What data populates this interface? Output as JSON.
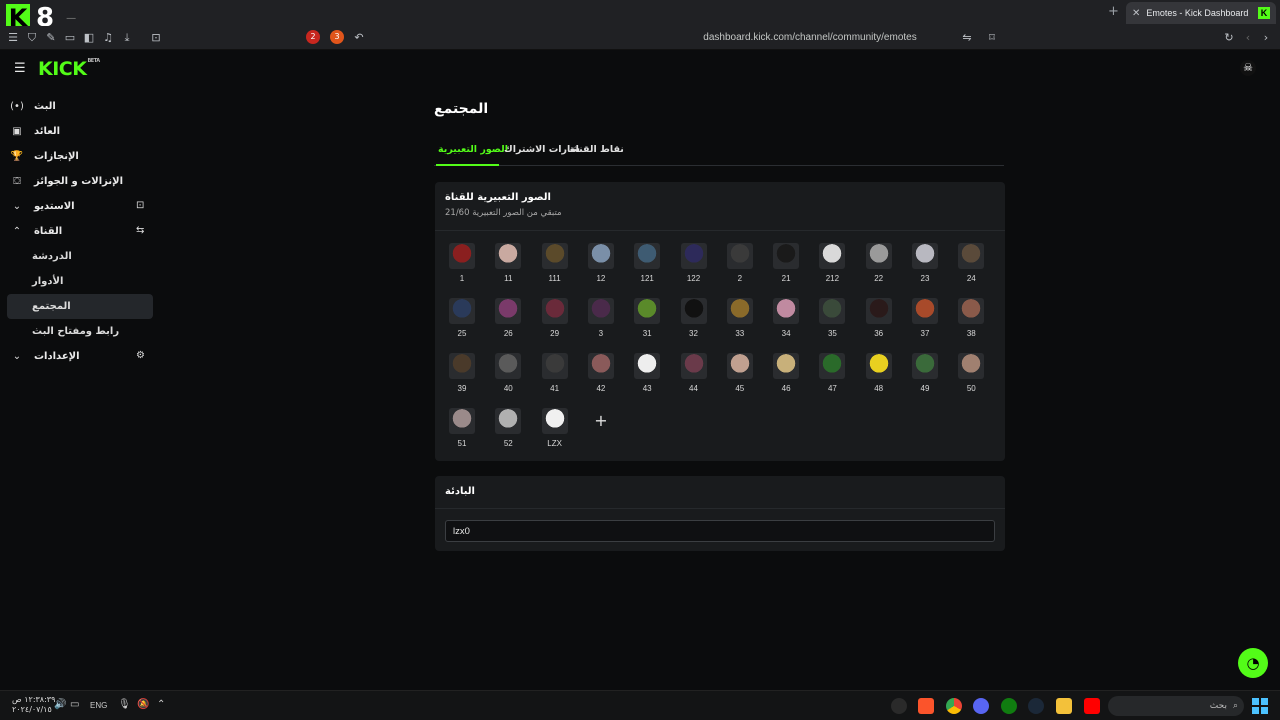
{
  "browser": {
    "logo_number": "8",
    "active_tab_title": "Emotes - Kick Dashboard",
    "url": "dashboard.kick.com/channel/community/emotes",
    "ext_badge_1": "2",
    "ext_badge_2": "3"
  },
  "header": {
    "logo": "KICK",
    "logo_badge": "BETA"
  },
  "sidebar": {
    "items": [
      {
        "label": "البث",
        "icon": "broadcast-icon",
        "glyph": "(•)"
      },
      {
        "label": "العائد",
        "icon": "revenue-icon",
        "glyph": "▣"
      },
      {
        "label": "الإنجازات",
        "icon": "trophy-icon",
        "glyph": "🏆"
      },
      {
        "label": "الإنزالات و الجوائز",
        "icon": "drops-icon",
        "glyph": "⛋"
      },
      {
        "label": "الاستديو",
        "icon": "chevron-down-icon",
        "glyph": "⌄",
        "right": "⊡"
      },
      {
        "label": "القناة",
        "icon": "chevron-up-icon",
        "glyph": "⌃",
        "right": "⇆"
      }
    ],
    "channel_sub": [
      "الدردشة",
      "الأدوار",
      "المجتمع",
      "رابط ومفتاح البث"
    ],
    "settings": {
      "label": "الإعدادات",
      "glyph": "⌄",
      "right": "⚙"
    }
  },
  "main": {
    "page_title": "المجتمع",
    "tabs": [
      "الصور التعبيرية",
      "شارات الاشتراك",
      "نقاط القناة"
    ],
    "active_tab": "الصور التعبيرية",
    "emotes_card": {
      "title": "الصور التعبيرية للقناة",
      "subtitle": "21/60 متبقي من الصور التعبيرية",
      "emotes": [
        "1",
        "11",
        "111",
        "12",
        "121",
        "122",
        "2",
        "21",
        "212",
        "22",
        "23",
        "24",
        "25",
        "26",
        "29",
        "3",
        "31",
        "32",
        "33",
        "34",
        "35",
        "36",
        "37",
        "38",
        "39",
        "40",
        "41",
        "42",
        "43",
        "44",
        "45",
        "46",
        "47",
        "48",
        "49",
        "50",
        "51",
        "52",
        "LZX"
      ],
      "add_label": "+"
    },
    "prefix_card": {
      "title": "البادئة",
      "value": "lzx0"
    }
  },
  "taskbar": {
    "time": "١٢:٣٨:٣٩ ص",
    "date": "٢٠٢٤/٠٧/١٥",
    "lang": "ENG",
    "search_placeholder": "بحث"
  },
  "colors": {
    "accent": "#53fc18",
    "background": "#0b0c0d",
    "card": "#191b1d"
  }
}
